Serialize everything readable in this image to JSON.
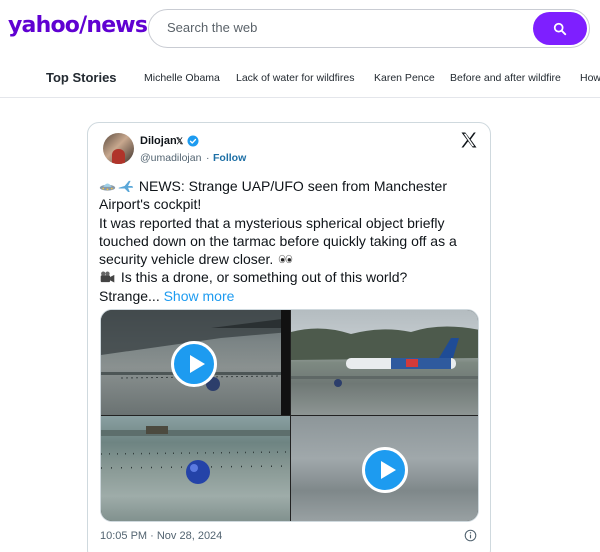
{
  "header": {
    "logo_text": "yahoo",
    "logo_slash": "/",
    "logo_news": "news",
    "search_placeholder": "Search the web"
  },
  "nav": {
    "items": [
      {
        "label": "Top Stories"
      },
      {
        "label": "Michelle Obama"
      },
      {
        "label": "Lack of water for wildfires"
      },
      {
        "label": "Karen Pence"
      },
      {
        "label": "Before and after wildfire"
      },
      {
        "label": "How"
      }
    ]
  },
  "tweet": {
    "display_name": "Dilojan",
    "x_badge": "𝕏",
    "handle": "@umadilojan",
    "separator": "·",
    "follow_label": "Follow",
    "text_lines": [
      "NEWS: Strange UAP/UFO seen from Manchester",
      "Airport's cockpit!",
      "It was reported that a mysterious spherical object briefly",
      "touched down on the tarmac before quickly taking off as a",
      "security vehicle drew closer.",
      "Is this a drone, or something out of this world?",
      "Strange..."
    ],
    "show_more_label": "Show more",
    "timestamp": "10:05 PM · Nov 28, 2024",
    "icons": [
      "ufo-emoji-icon",
      "airplane-emoji-icon",
      "eyes-emoji-icon",
      "camera-emoji-icon",
      "verified-badge-icon",
      "x-logo-icon",
      "info-icon",
      "play-icon",
      "search-icon"
    ]
  },
  "colors": {
    "brand": "#6001d2",
    "search_button": "#7e1fff",
    "link": "#1d9bf0",
    "play_button": "#1d9bf0"
  }
}
